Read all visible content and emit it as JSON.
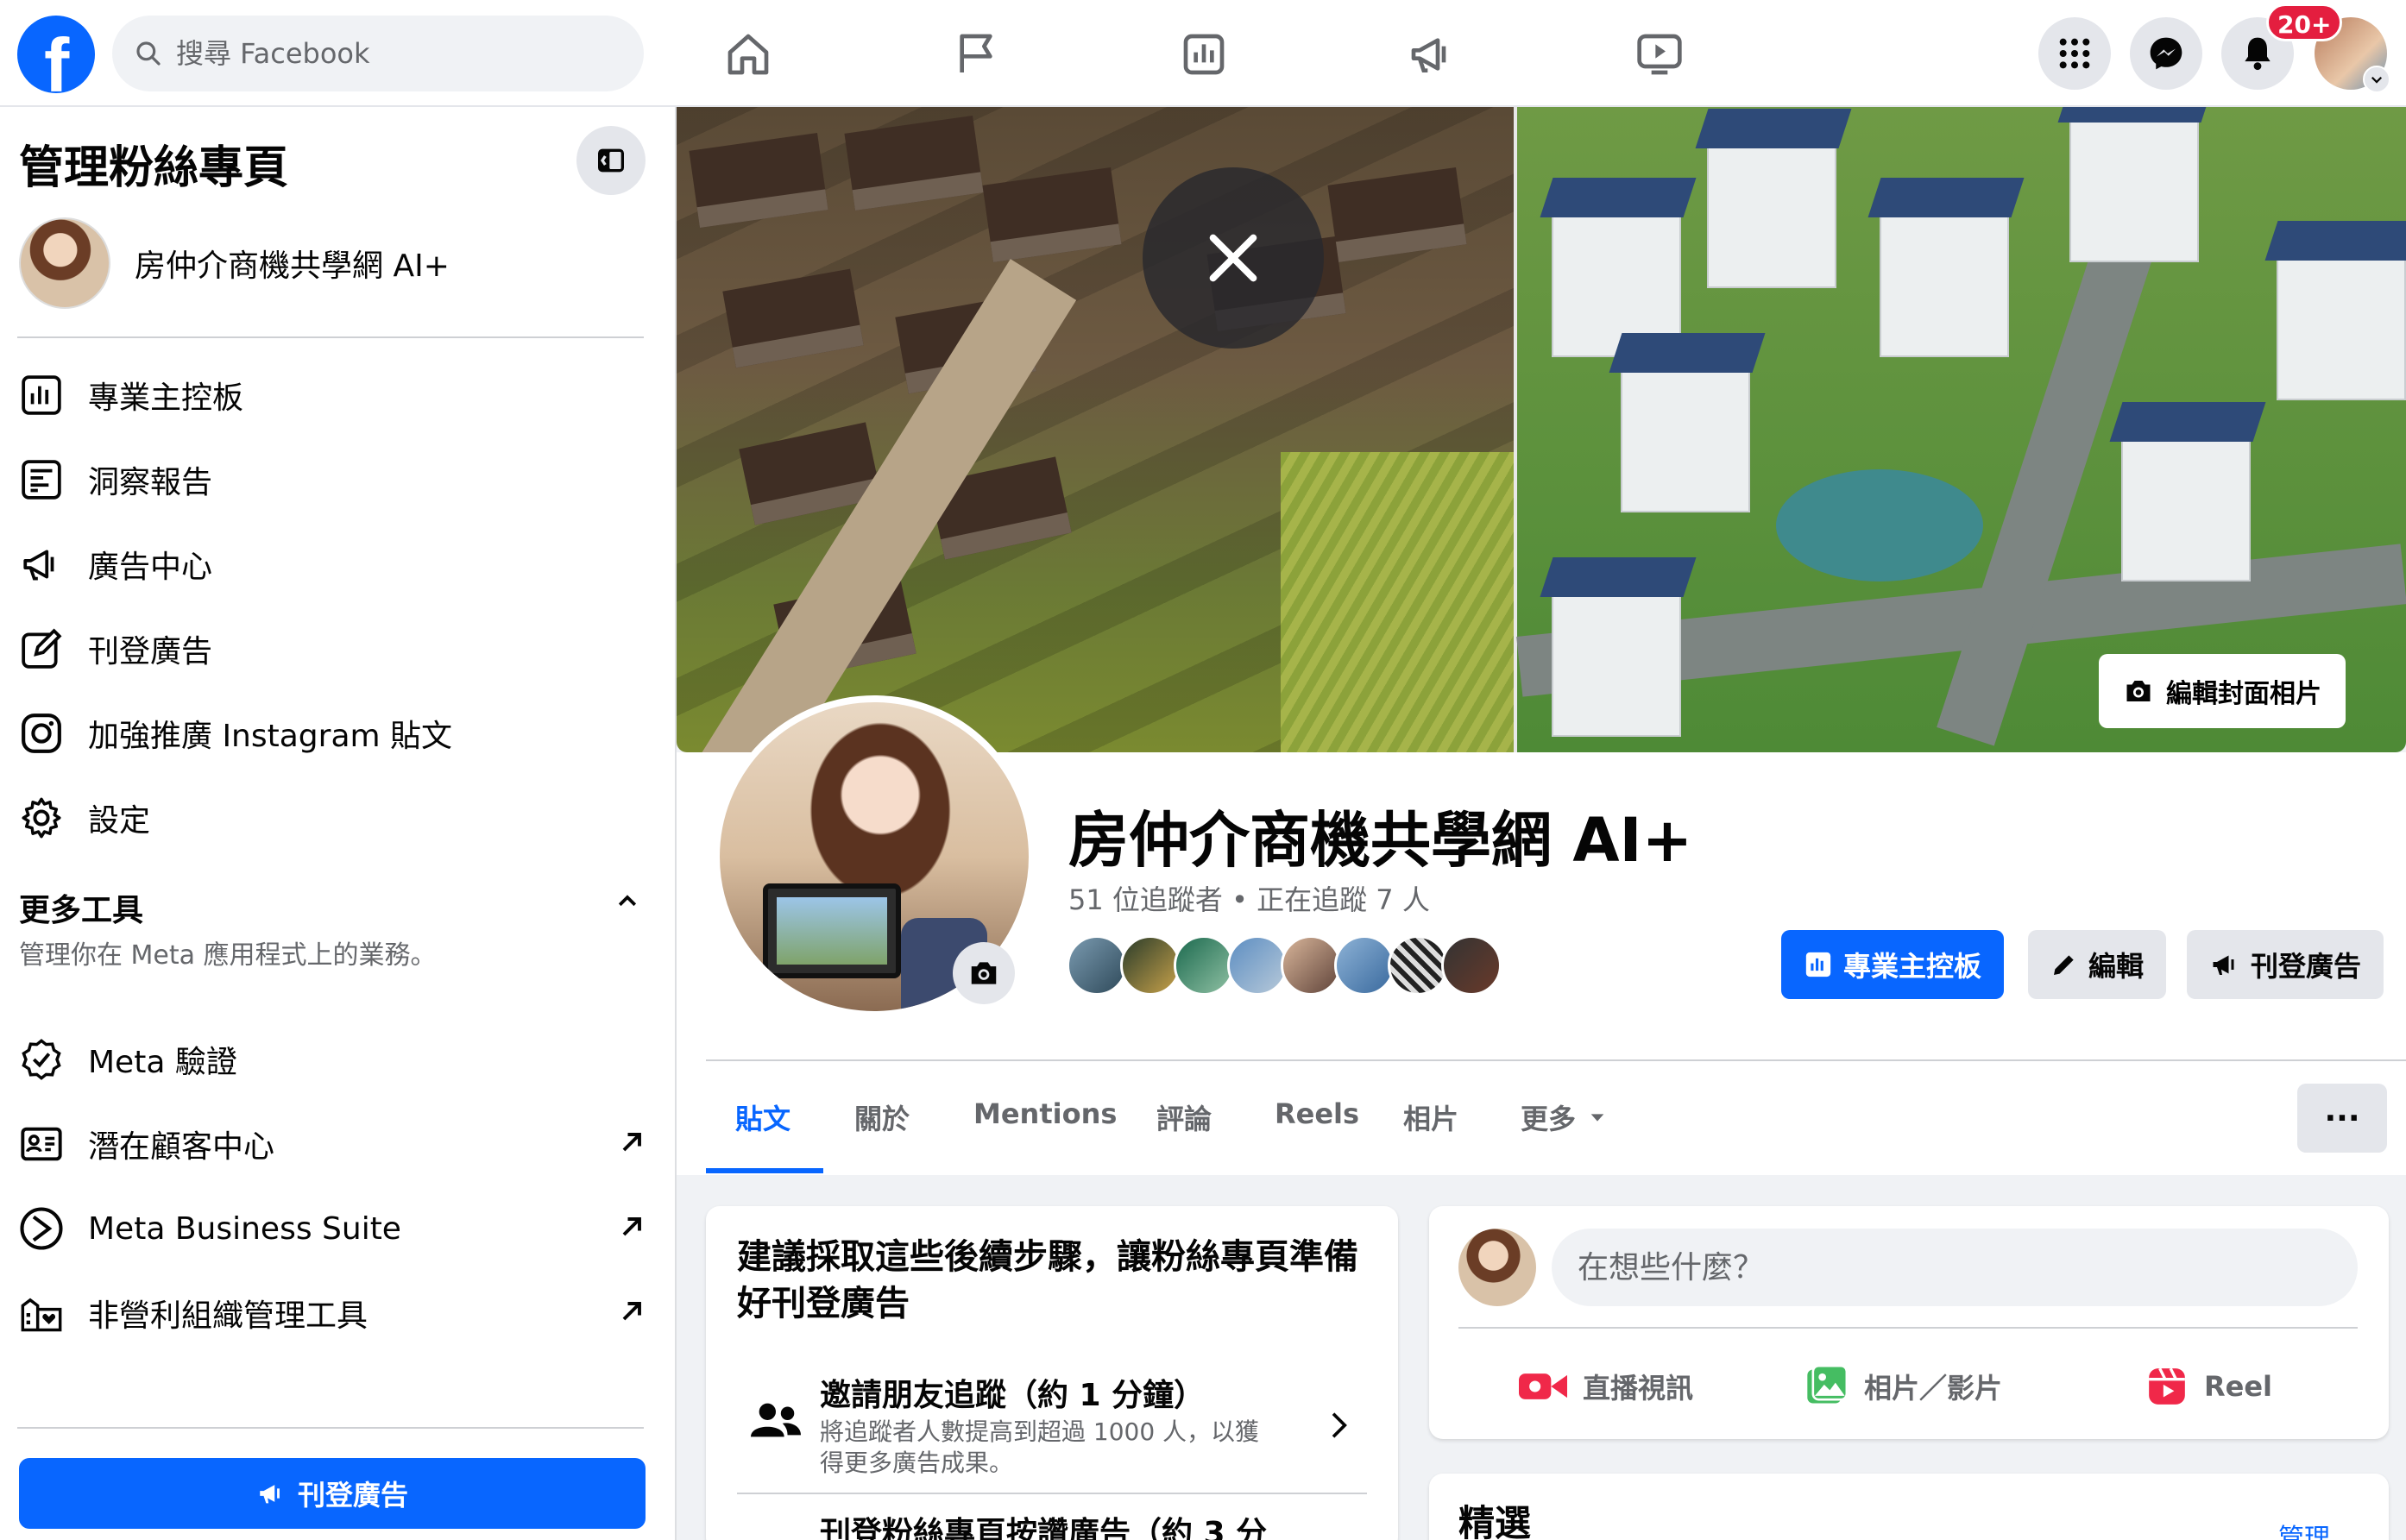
{
  "topbar": {
    "search_placeholder": "搜尋 Facebook",
    "notification_count": "20+"
  },
  "sidebar": {
    "title": "管理粉絲專頁",
    "page_name": "房仲介商機共學網 AI+",
    "items": [
      {
        "label": "專業主控板",
        "icon": "dashboard-icon"
      },
      {
        "label": "洞察報告",
        "icon": "insights-icon"
      },
      {
        "label": "廣告中心",
        "icon": "megaphone-icon"
      },
      {
        "label": "刊登廣告",
        "icon": "edit-icon"
      },
      {
        "label": "加強推廣 Instagram 貼文",
        "icon": "instagram-icon"
      },
      {
        "label": "設定",
        "icon": "gear-icon"
      }
    ],
    "more_tools_title": "更多工具",
    "more_tools_sub": "管理你在 Meta 應用程式上的業務。",
    "tools": [
      {
        "label": "Meta 驗證",
        "icon": "verified-icon"
      },
      {
        "label": "潛在顧客中心",
        "icon": "contact-card-icon"
      },
      {
        "label": "Meta Business Suite",
        "icon": "business-suite-icon"
      },
      {
        "label": "非營利組織管理工具",
        "icon": "nonprofit-icon"
      }
    ],
    "cta_label": "刊登廣告"
  },
  "cover": {
    "edit_label": "編輯封面相片"
  },
  "profile": {
    "name": "房仲介商機共學網 AI+",
    "stats": "51 位追蹤者 • 正在追蹤 7 人",
    "buttons": {
      "dashboard": "專業主控板",
      "edit": "編輯",
      "advertise": "刊登廣告"
    },
    "tabs": [
      "貼文",
      "關於",
      "Mentions",
      "評論",
      "Reels",
      "相片",
      "更多"
    ],
    "more_options": "···"
  },
  "steps_card": {
    "title": "建議採取這些後續步驟，讓粉絲專頁準備好刊登廣告",
    "step1_title": "邀請朋友追蹤（約 1 分鐘）",
    "step1_desc": "將追蹤者人數提高到超過 1000 人，以獲得更多廣告成果。",
    "step2_title": "刊登粉絲專頁按讚廣告（約 3 分"
  },
  "composer": {
    "placeholder": "在想些什麼？",
    "actions": [
      "直播視訊",
      "相片／影片",
      "Reel"
    ]
  },
  "featured": {
    "title": "精選",
    "manage": "管理"
  },
  "colors": {
    "brand_blue": "#0866ff",
    "live_red": "#f02849",
    "photo_green": "#45bd62",
    "badge_red": "#e41e3f"
  }
}
